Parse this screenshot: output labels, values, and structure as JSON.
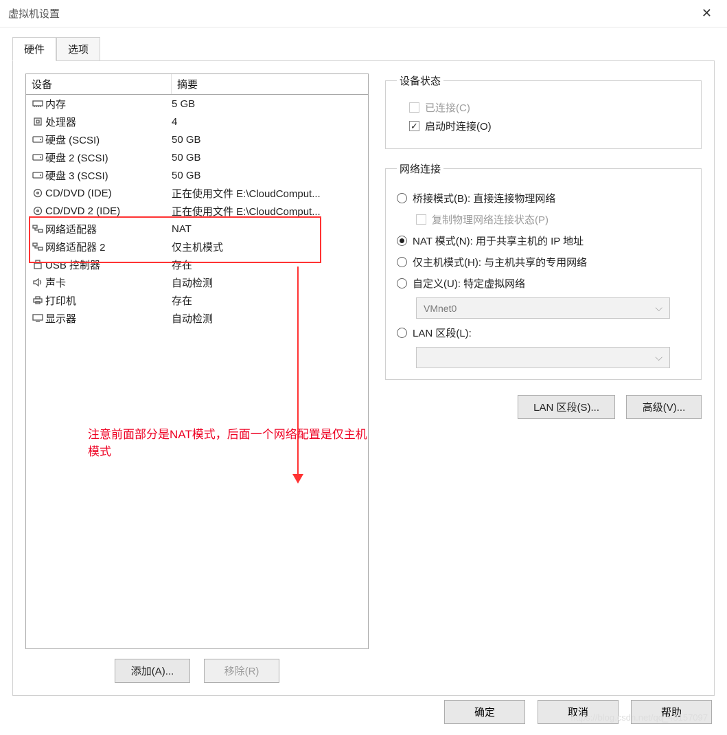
{
  "title": "虚拟机设置",
  "tabs": {
    "hardware": "硬件",
    "options": "选项"
  },
  "list": {
    "hdr_device": "设备",
    "hdr_summary": "摘要",
    "rows": [
      {
        "icon": "memory",
        "name": "内存",
        "summary": "5 GB"
      },
      {
        "icon": "cpu",
        "name": "处理器",
        "summary": "4"
      },
      {
        "icon": "disk",
        "name": "硬盘 (SCSI)",
        "summary": "50 GB"
      },
      {
        "icon": "disk",
        "name": "硬盘 2 (SCSI)",
        "summary": "50 GB"
      },
      {
        "icon": "disk",
        "name": "硬盘 3 (SCSI)",
        "summary": "50 GB"
      },
      {
        "icon": "cd",
        "name": "CD/DVD (IDE)",
        "summary": "正在使用文件 E:\\CloudComput..."
      },
      {
        "icon": "cd",
        "name": "CD/DVD 2 (IDE)",
        "summary": "正在使用文件 E:\\CloudComput..."
      },
      {
        "icon": "net",
        "name": "网络适配器",
        "summary": "NAT"
      },
      {
        "icon": "net",
        "name": "网络适配器 2",
        "summary": "仅主机模式"
      },
      {
        "icon": "usb",
        "name": "USB 控制器",
        "summary": "存在"
      },
      {
        "icon": "sound",
        "name": "声卡",
        "summary": "自动检测"
      },
      {
        "icon": "print",
        "name": "打印机",
        "summary": "存在"
      },
      {
        "icon": "display",
        "name": "显示器",
        "summary": "自动检测"
      }
    ]
  },
  "annotation": "注意前面部分是NAT模式，后面一个网络配置是仅主机模式",
  "btn_add": "添加(A)...",
  "btn_remove": "移除(R)",
  "group_state": {
    "legend": "设备状态",
    "connected": "已连接(C)",
    "connect_at_poweron": "启动时连接(O)"
  },
  "group_net": {
    "legend": "网络连接",
    "bridged": "桥接模式(B): 直接连接物理网络",
    "replicate": "复制物理网络连接状态(P)",
    "nat": "NAT 模式(N): 用于共享主机的 IP 地址",
    "hostonly": "仅主机模式(H): 与主机共享的专用网络",
    "custom": "自定义(U): 特定虚拟网络",
    "custom_val": "VMnet0",
    "lan": "LAN 区段(L):",
    "lan_val": ""
  },
  "btn_lan": "LAN 区段(S)...",
  "btn_adv": "高级(V)...",
  "btn_ok": "确定",
  "btn_cancel": "取消",
  "btn_help": "帮助",
  "watermark": "https://blog.csdn.net/qq_48157097"
}
